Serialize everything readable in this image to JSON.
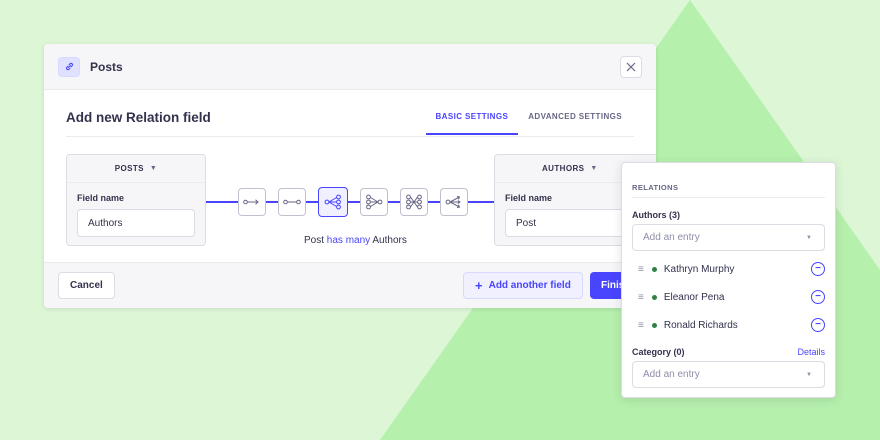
{
  "colors": {
    "primary": "#4945ff",
    "background": "#dcf6d6",
    "background_triangle": "#b6f0ad",
    "status_dot": "#328048"
  },
  "modal": {
    "header_title": "Posts",
    "header_icon": "link-icon",
    "close_icon": "close-icon",
    "section_title": "Add new Relation field",
    "tabs": [
      {
        "label": "BASIC SETTINGS",
        "active": true
      },
      {
        "label": "ADVANCED SETTINGS",
        "active": false
      }
    ],
    "left_box": {
      "header": "POSTS",
      "field_label": "Field name",
      "field_value": "Authors"
    },
    "right_box": {
      "header": "AUTHORS",
      "field_label": "Field name",
      "field_value": "Post"
    },
    "relation_icons": [
      "one-way-icon",
      "one-to-one-icon",
      "one-to-many-icon",
      "many-to-one-icon",
      "many-to-many-icon",
      "many-way-icon"
    ],
    "relation_text": {
      "prefix": "Post",
      "highlight": "has many",
      "suffix": "Authors"
    },
    "footer": {
      "cancel_label": "Cancel",
      "add_label": "Add another field",
      "finish_label": "Finish"
    }
  },
  "panel": {
    "title": "RELATIONS",
    "authors_label": "Authors (3)",
    "authors_placeholder": "Add an entry",
    "entries": [
      "Kathryn Murphy",
      "Eleanor Pena",
      "Ronald Richards"
    ],
    "category_label": "Category (0)",
    "details_label": "Details",
    "category_placeholder": "Add an entry"
  }
}
